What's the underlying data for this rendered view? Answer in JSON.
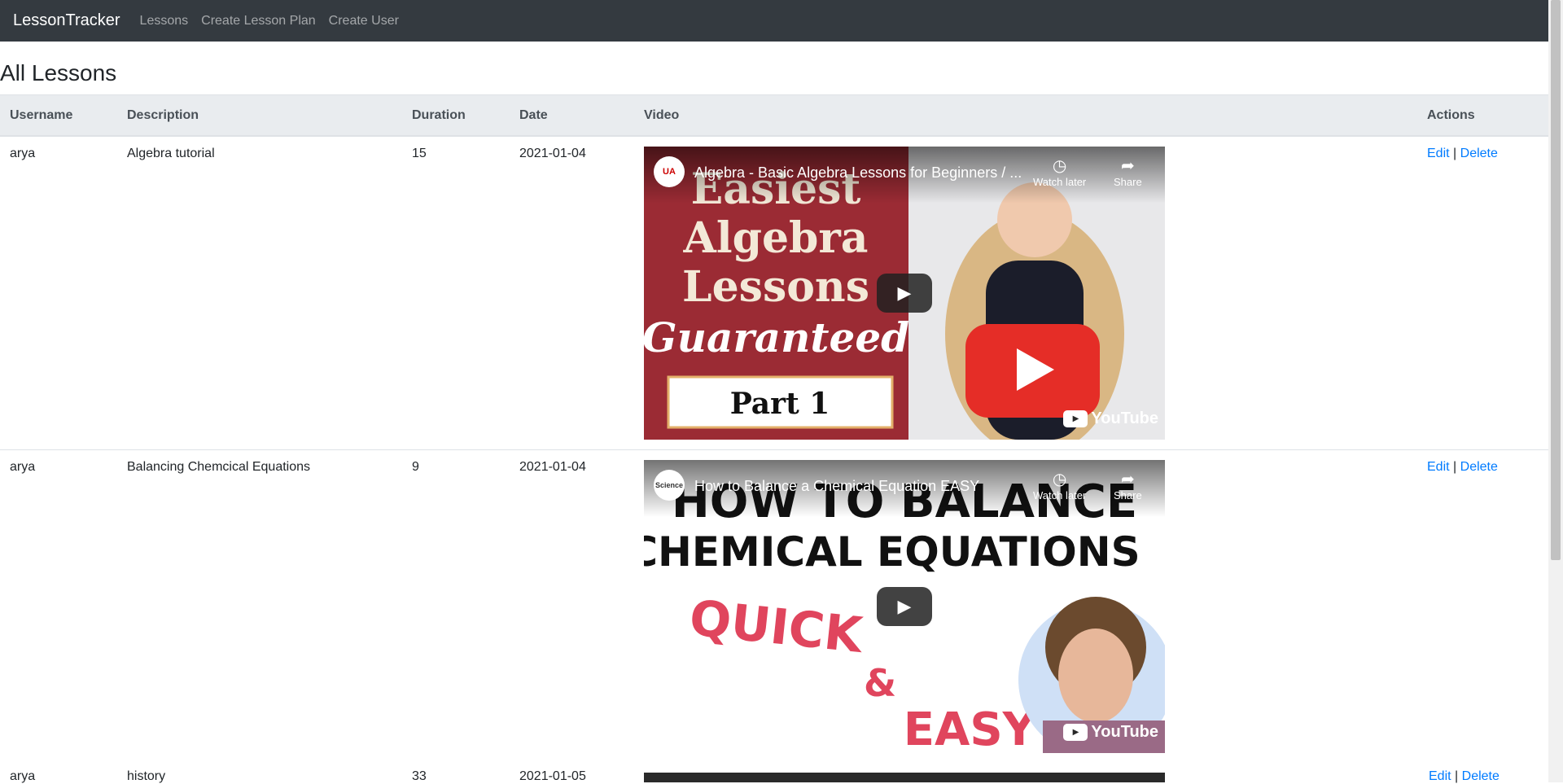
{
  "nav": {
    "brand": "LessonTracker",
    "links": [
      "Lessons",
      "Create Lesson Plan",
      "Create User"
    ]
  },
  "page_title": "All Lessons",
  "table": {
    "headers": [
      "Username",
      "Description",
      "Duration",
      "Date",
      "Video",
      "Actions"
    ],
    "rows": [
      {
        "username": "arya",
        "description": "Algebra tutorial",
        "duration": "15",
        "date": "2021-01-04",
        "video": {
          "title": "Algebra - Basic Algebra Lessons for Beginners / ...",
          "channel_logo": "UA",
          "thumb_lines": [
            "Easiest",
            "Algebra",
            "Lessons",
            "Guaranteed",
            "Part 1"
          ]
        },
        "edit": "Edit",
        "sep": "|",
        "delete": "Delete"
      },
      {
        "username": "arya",
        "description": "Balancing Chemcical Equations",
        "duration": "9",
        "date": "2021-01-04",
        "video": {
          "title": "How to Balance a Chemical Equation EASY",
          "channel_logo": "Science",
          "thumb_lines": [
            "HOW TO BALANCE",
            "CHEMICAL EQUATIONS",
            "QUICK",
            "&",
            "EASY"
          ]
        },
        "edit": "Edit",
        "sep": "|",
        "delete": "Delete"
      },
      {
        "username": "arya",
        "description": "history",
        "duration": "33",
        "date": "2021-01-05",
        "edit": "Edit",
        "sep": "|",
        "delete": "Delete"
      }
    ]
  },
  "video_controls": {
    "watch_later": "Watch later",
    "share": "Share",
    "brand": "YouTube"
  },
  "colors": {
    "navbar": "#343a40",
    "header_bg": "#e9ecef",
    "link": "#007bff",
    "youtube_red": "#ff0000"
  }
}
